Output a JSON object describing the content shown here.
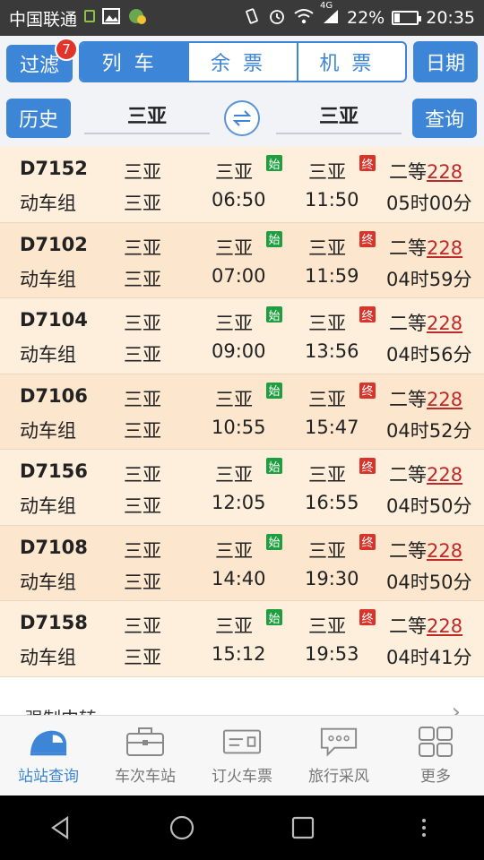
{
  "status_bar": {
    "carrier": "中国联通",
    "battery": "22%",
    "battery_level": 0.22,
    "network": "4G",
    "time": "20:35",
    "icons": [
      "sim-icon",
      "image-icon",
      "app-icon",
      "vibrate-icon",
      "alarm-icon",
      "wifi-icon",
      "signal-icon",
      "battery-icon"
    ]
  },
  "header": {
    "filter_label": "过滤",
    "filter_badge": "7",
    "tabs": [
      {
        "label": "列车",
        "active": true
      },
      {
        "label": "余票",
        "active": false
      },
      {
        "label": "机票",
        "active": false
      }
    ],
    "date_label": "日期",
    "history_label": "历史",
    "from_station": "三亚",
    "to_station": "三亚",
    "query_label": "查询"
  },
  "trains": [
    {
      "no": "D7152",
      "type": "动车组",
      "origin": "三亚",
      "dep_station": "三亚",
      "dep_time": "06:50",
      "arr_station": "三亚",
      "arr_time": "11:50",
      "seat": "二等",
      "price": "228",
      "duration": "05时00分",
      "start_tag": "始",
      "end_tag": "终"
    },
    {
      "no": "D7102",
      "type": "动车组",
      "origin": "三亚",
      "dep_station": "三亚",
      "dep_time": "07:00",
      "arr_station": "三亚",
      "arr_time": "11:59",
      "seat": "二等",
      "price": "228",
      "duration": "04时59分",
      "start_tag": "始",
      "end_tag": "终"
    },
    {
      "no": "D7104",
      "type": "动车组",
      "origin": "三亚",
      "dep_station": "三亚",
      "dep_time": "09:00",
      "arr_station": "三亚",
      "arr_time": "13:56",
      "seat": "二等",
      "price": "228",
      "duration": "04时56分",
      "start_tag": "始",
      "end_tag": "终"
    },
    {
      "no": "D7106",
      "type": "动车组",
      "origin": "三亚",
      "dep_station": "三亚",
      "dep_time": "10:55",
      "arr_station": "三亚",
      "arr_time": "15:47",
      "seat": "二等",
      "price": "228",
      "duration": "04时52分",
      "start_tag": "始",
      "end_tag": "终"
    },
    {
      "no": "D7156",
      "type": "动车组",
      "origin": "三亚",
      "dep_station": "三亚",
      "dep_time": "12:05",
      "arr_station": "三亚",
      "arr_time": "16:55",
      "seat": "二等",
      "price": "228",
      "duration": "04时50分",
      "start_tag": "始",
      "end_tag": "终"
    },
    {
      "no": "D7108",
      "type": "动车组",
      "origin": "三亚",
      "dep_station": "三亚",
      "dep_time": "14:40",
      "arr_station": "三亚",
      "arr_time": "19:30",
      "seat": "二等",
      "price": "228",
      "duration": "04时50分",
      "start_tag": "始",
      "end_tag": "终"
    },
    {
      "no": "D7158",
      "type": "动车组",
      "origin": "三亚",
      "dep_station": "三亚",
      "dep_time": "15:12",
      "arr_station": "三亚",
      "arr_time": "19:53",
      "seat": "二等",
      "price": "228",
      "duration": "04时41分",
      "start_tag": "始",
      "end_tag": "终"
    }
  ],
  "more_row": {
    "label": "强制中转",
    "icon": "chevron-right-icon"
  },
  "bottom_nav": [
    {
      "label": "站站查询",
      "icon": "train-icon",
      "active": true
    },
    {
      "label": "车次车站",
      "icon": "briefcase-icon",
      "active": false
    },
    {
      "label": "订火车票",
      "icon": "ticket-icon",
      "active": false
    },
    {
      "label": "旅行采风",
      "icon": "chat-bubble-icon",
      "active": false
    },
    {
      "label": "更多",
      "icon": "grid-icon",
      "active": false
    }
  ],
  "colors": {
    "accent": "#3d85d6",
    "row_bg": "#fdefdc",
    "row_bg_alt": "#fce6cd",
    "price": "#c0292a",
    "start_tag": "#1e9e3f",
    "end_tag": "#d9342b",
    "badge": "#e2342a"
  }
}
